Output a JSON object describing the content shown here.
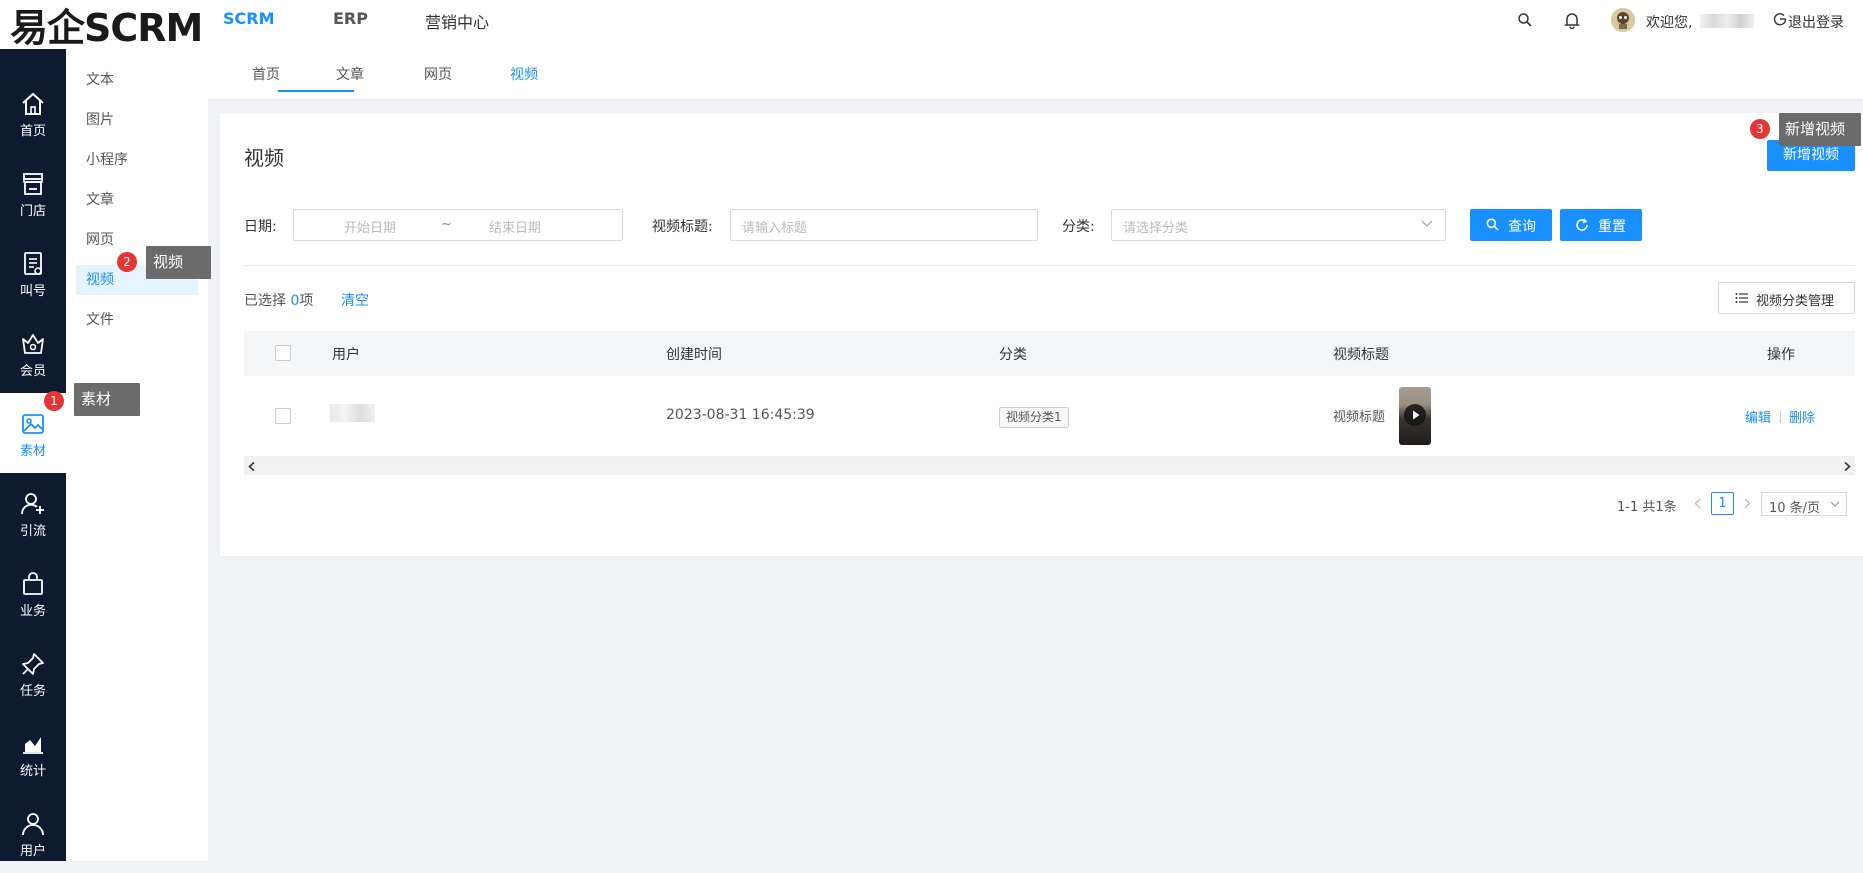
{
  "app": {
    "logo": "易企SCRM"
  },
  "top_nav": {
    "items": [
      "SCRM",
      "ERP",
      "营销中心"
    ],
    "welcome": "欢迎您,",
    "logout": "退出登录"
  },
  "sidebar": {
    "items": [
      {
        "label": "首页",
        "icon": "home-icon"
      },
      {
        "label": "门店",
        "icon": "store-icon"
      },
      {
        "label": "叫号",
        "icon": "queue-icon"
      },
      {
        "label": "会员",
        "icon": "member-icon"
      },
      {
        "label": "素材",
        "icon": "image-icon",
        "active": true
      },
      {
        "label": "引流",
        "icon": "user-plus-icon"
      },
      {
        "label": "业务",
        "icon": "bag-icon"
      },
      {
        "label": "任务",
        "icon": "pin-icon"
      },
      {
        "label": "统计",
        "icon": "chart-icon"
      },
      {
        "label": "用户",
        "icon": "user-icon"
      }
    ]
  },
  "submenu": {
    "items": [
      "文本",
      "图片",
      "小程序",
      "文章",
      "网页",
      "视频",
      "文件"
    ],
    "active": "视频"
  },
  "tabs": {
    "items": [
      "首页",
      "文章",
      "网页",
      "视频"
    ],
    "active": "视频"
  },
  "page": {
    "title": "视频",
    "add_button": "新增视频"
  },
  "filters": {
    "date_label": "日期:",
    "start_placeholder": "开始日期",
    "separator": "~",
    "end_placeholder": "结束日期",
    "title_label": "视频标题:",
    "title_placeholder": "请输入标题",
    "category_label": "分类:",
    "category_placeholder": "请选择分类",
    "query_button": "查询",
    "reset_button": "重置"
  },
  "selection": {
    "prefix": "已选择",
    "count": "0",
    "suffix": "项",
    "clear": "清空"
  },
  "category_manage_button": "视频分类管理",
  "table": {
    "columns": [
      "用户",
      "创建时间",
      "分类",
      "视频标题",
      "操作"
    ],
    "rows": [
      {
        "created": "2023-08-31 16:45:39",
        "category": "视频分类1",
        "title": "视频标题",
        "actions": [
          "编辑",
          "删除"
        ]
      }
    ]
  },
  "pagination": {
    "info": "1-1 共1条",
    "current": "1",
    "page_size": "10 条/页"
  },
  "annotations": [
    {
      "number": "1",
      "text": "素材"
    },
    {
      "number": "2",
      "text": "视频"
    },
    {
      "number": "3",
      "text": "新增视频"
    }
  ],
  "colors": {
    "primary": "#1890ff",
    "sidebar": "#0e1a30",
    "badge": "#e63535"
  }
}
